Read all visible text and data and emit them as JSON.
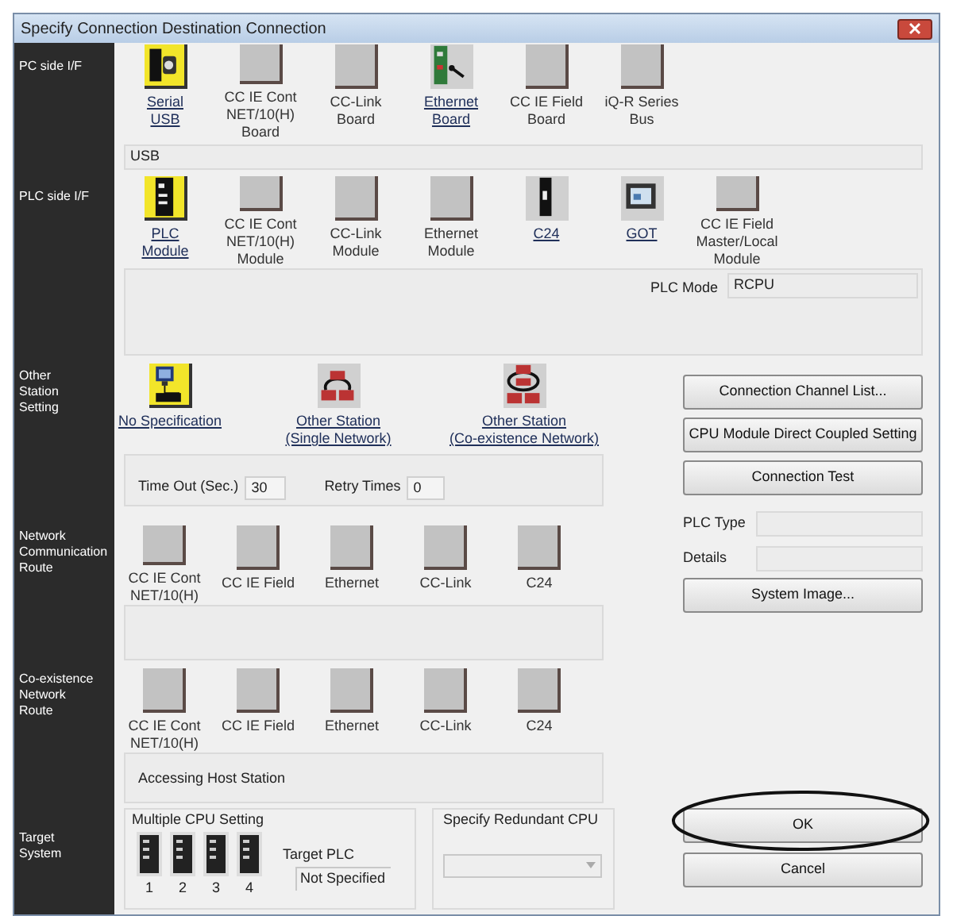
{
  "window": {
    "title": "Specify Connection Destination Connection"
  },
  "pc_side": {
    "label": "PC side I/F",
    "selection": "USB",
    "options": [
      {
        "label": "Serial\nUSB",
        "kind": "usb",
        "selected": true,
        "available": true
      },
      {
        "label": "CC IE Cont\nNET/10(H)\nBoard",
        "kind": "blank",
        "selected": false,
        "available": false
      },
      {
        "label": "CC-Link\nBoard",
        "kind": "blank",
        "selected": false,
        "available": false
      },
      {
        "label": "Ethernet\nBoard",
        "kind": "board",
        "selected": false,
        "available": true
      },
      {
        "label": "CC IE Field\nBoard",
        "kind": "blank",
        "selected": false,
        "available": false
      },
      {
        "label": "iQ-R Series\nBus",
        "kind": "blank",
        "selected": false,
        "available": false
      }
    ]
  },
  "plc_side": {
    "label": "PLC side I/F",
    "plc_mode_label": "PLC Mode",
    "plc_mode": "RCPU",
    "options": [
      {
        "label": "PLC\nModule",
        "kind": "plc",
        "selected": true,
        "available": true
      },
      {
        "label": "CC IE Cont\nNET/10(H)\nModule",
        "kind": "blank",
        "selected": false,
        "available": false
      },
      {
        "label": "CC-Link\nModule",
        "kind": "blank",
        "selected": false,
        "available": false
      },
      {
        "label": "Ethernet\nModule",
        "kind": "blank",
        "selected": false,
        "available": false
      },
      {
        "label": "C24",
        "kind": "module",
        "selected": false,
        "available": true
      },
      {
        "label": "GOT",
        "kind": "got",
        "selected": false,
        "available": true
      },
      {
        "label": "CC IE Field\nMaster/Local\nModule",
        "kind": "blank",
        "selected": false,
        "available": false
      }
    ]
  },
  "other_station": {
    "label": "Other\nStation\nSetting",
    "timeout_label": "Time Out (Sec.)",
    "timeout": "30",
    "retry_label": "Retry Times",
    "retry": "0",
    "options": [
      {
        "label": "No Specification",
        "kind": "pc",
        "selected": true,
        "available": true
      },
      {
        "label": "Other Station\n(Single Network)",
        "kind": "network",
        "selected": false,
        "available": true
      },
      {
        "label": "Other Station\n(Co-existence Network)",
        "kind": "network_multi",
        "selected": false,
        "available": true
      }
    ]
  },
  "network_route": {
    "label": "Network\nCommunication\nRoute",
    "options": [
      {
        "label": "CC IE Cont\nNET/10(H)",
        "kind": "blank",
        "selected": false,
        "available": false
      },
      {
        "label": "CC IE Field",
        "kind": "blank",
        "selected": false,
        "available": false
      },
      {
        "label": "Ethernet",
        "kind": "blank",
        "selected": false,
        "available": false
      },
      {
        "label": "CC-Link",
        "kind": "blank",
        "selected": false,
        "available": false
      },
      {
        "label": "C24",
        "kind": "blank",
        "selected": false,
        "available": false
      }
    ]
  },
  "coexistence_route": {
    "label": "Co-existence\nNetwork\nRoute",
    "status": "Accessing Host Station",
    "options": [
      {
        "label": "CC IE Cont\nNET/10(H)",
        "kind": "blank",
        "selected": false,
        "available": false
      },
      {
        "label": "CC IE Field",
        "kind": "blank",
        "selected": false,
        "available": false
      },
      {
        "label": "Ethernet",
        "kind": "blank",
        "selected": false,
        "available": false
      },
      {
        "label": "CC-Link",
        "kind": "blank",
        "selected": false,
        "available": false
      },
      {
        "label": "C24",
        "kind": "blank",
        "selected": false,
        "available": false
      }
    ]
  },
  "target_system": {
    "label": "Target\nSystem",
    "multiple_cpu_title": "Multiple CPU Setting",
    "cpus": [
      {
        "label": "1"
      },
      {
        "label": "2"
      },
      {
        "label": "3"
      },
      {
        "label": "4"
      }
    ],
    "target_plc_label": "Target PLC",
    "target_plc": "Not Specified",
    "redundant_title": "Specify Redundant CPU",
    "redundant_disabled": true
  },
  "side_panel": {
    "buttons_top": [
      "Connection Channel List...",
      "CPU Module Direct Coupled Setting",
      "Connection Test"
    ],
    "plc_type_label": "PLC Type",
    "details_label": "Details",
    "system_image": "System Image...",
    "ok": "OK",
    "cancel": "Cancel",
    "ok_highlighted": true
  }
}
